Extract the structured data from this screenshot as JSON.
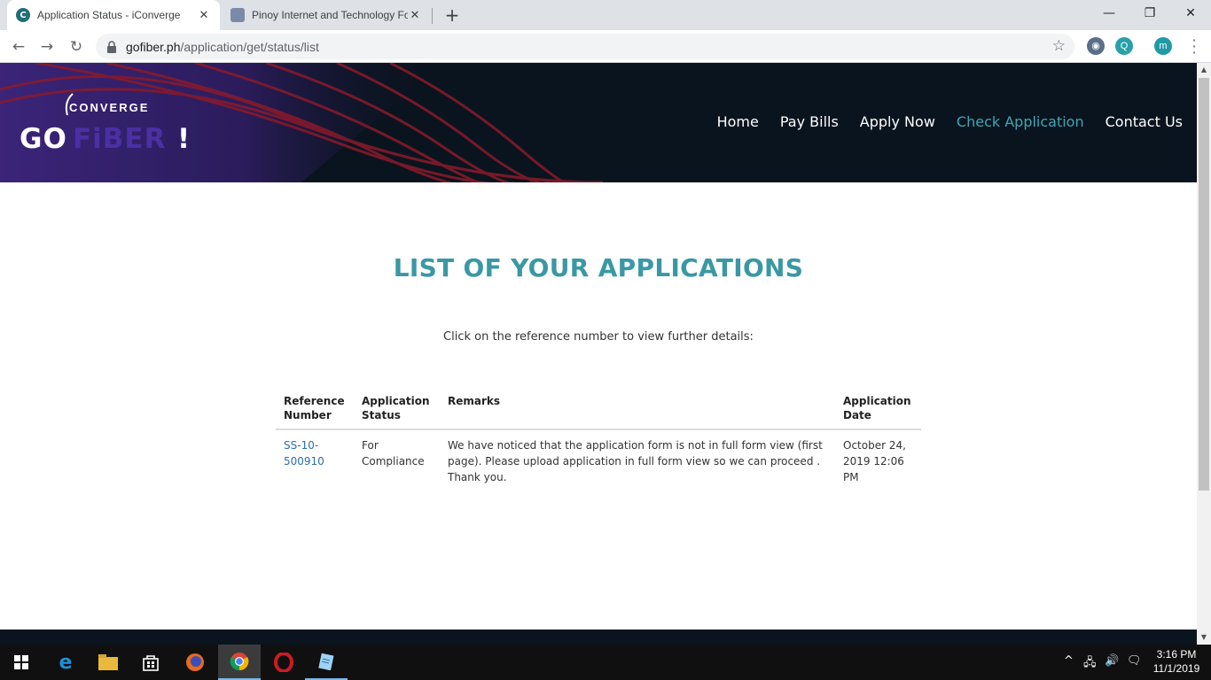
{
  "browser": {
    "tabs": [
      {
        "title": "Application Status - iConverge",
        "active": true
      },
      {
        "title": "Pinoy Internet and Technology Fo",
        "active": false
      }
    ],
    "url_domain": "gofiber.ph",
    "url_path": "/application/get/status/list",
    "profile_initial": "m",
    "ext_initial": "Q"
  },
  "site": {
    "logo_converge": "CONVERGE",
    "logo_go": "GO",
    "logo_fiber": "FiBER",
    "logo_bang": "!",
    "nav": [
      "Home",
      "Pay Bills",
      "Apply Now",
      "Check Application",
      "Contact Us"
    ],
    "nav_active": "Check Application"
  },
  "main": {
    "title": "LIST OF YOUR APPLICATIONS",
    "instructions": "Click on the reference number to view further details:",
    "table": {
      "headers": [
        "Reference Number",
        "Application Status",
        "Remarks",
        "Application Date"
      ],
      "rows": [
        {
          "reference": "SS-10-500910",
          "status": "For Compliance",
          "remarks": "We have noticed that the application form is not in full form view (first page). Please upload application in full form view so we can proceed . Thank you.",
          "date": "October 24, 2019 12:06 PM"
        }
      ]
    }
  },
  "taskbar": {
    "time": "3:16 PM",
    "date": "11/1/2019"
  },
  "colors": {
    "accent": "#3a98a4",
    "header_bg": "#0a141e",
    "nav_active": "#3ea6b6",
    "link": "#2a6fa8"
  }
}
